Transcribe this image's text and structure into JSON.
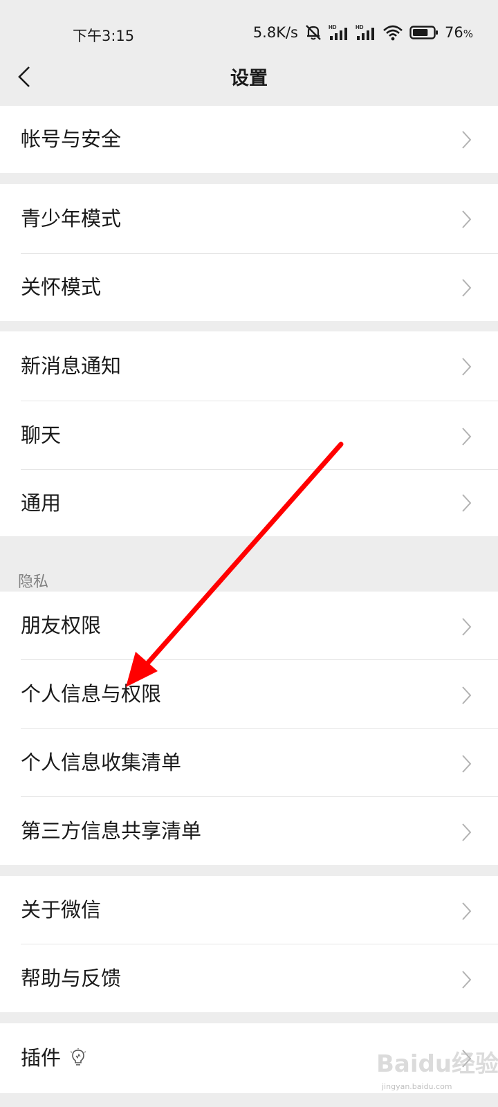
{
  "status_bar": {
    "time": "下午3:15",
    "network_speed": "5.8K/s",
    "battery": "76",
    "battery_level": 0.76,
    "icons": [
      "mute-bell-icon",
      "hd-signal-icon",
      "hd-signal-icon",
      "wifi-icon",
      "battery-icon"
    ]
  },
  "header": {
    "title": "设置",
    "back_icon": "chevron-left-icon"
  },
  "groups": {
    "account": {
      "items": [
        {
          "label": "帐号与安全"
        }
      ]
    },
    "modes": {
      "items": [
        {
          "label": "青少年模式"
        },
        {
          "label": "关怀模式"
        }
      ]
    },
    "general": {
      "items": [
        {
          "label": "新消息通知"
        },
        {
          "label": "聊天"
        },
        {
          "label": "通用"
        }
      ]
    },
    "privacy": {
      "header": "隐私",
      "items": [
        {
          "label": "朋友权限"
        },
        {
          "label": "个人信息与权限"
        },
        {
          "label": "个人信息收集清单"
        },
        {
          "label": "第三方信息共享清单"
        }
      ]
    },
    "about": {
      "items": [
        {
          "label": "关于微信"
        },
        {
          "label": "帮助与反馈"
        }
      ]
    },
    "plugins": {
      "items": [
        {
          "label": "插件",
          "icon": "lightbulb-icon"
        }
      ]
    }
  },
  "annotation": {
    "type": "red-arrow",
    "color": "#ff0000",
    "points_to": "个人信息与权限"
  },
  "watermark": {
    "logo": "Baidu经验",
    "url": "jingyan.baidu.com"
  },
  "colors": {
    "background": "#ededed",
    "card": "#ffffff",
    "divider": "#e5e5e5",
    "chevron": "#b2b2b2",
    "section_text": "#808080"
  }
}
